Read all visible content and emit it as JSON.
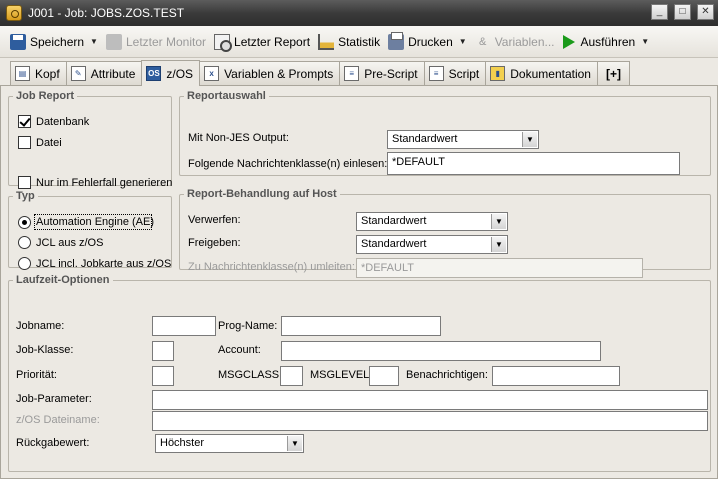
{
  "window": {
    "title": "J001 - Job: JOBS.ZOS.TEST",
    "min": "_",
    "max": "□",
    "close": "✕"
  },
  "toolbar": {
    "save": "Speichern",
    "last_monitor": "Letzter Monitor",
    "last_report": "Letzter Report",
    "statistics": "Statistik",
    "print": "Drucken",
    "variables": "Variablen...",
    "run": "Ausführen",
    "arrow": "▼"
  },
  "tabs": [
    {
      "label": "Kopf"
    },
    {
      "label": "Attribute"
    },
    {
      "label": "z/OS"
    },
    {
      "label": "Variablen & Prompts"
    },
    {
      "label": "Pre-Script"
    },
    {
      "label": "Script"
    },
    {
      "label": "Dokumentation"
    },
    {
      "label": "[+]"
    }
  ],
  "job_report": {
    "legend": "Job Report",
    "database": "Datenbank",
    "database_checked": true,
    "file": "Datei",
    "file_checked": false,
    "only_on_error": "Nur im Fehlerfall generieren",
    "only_on_error_checked": false
  },
  "report_selection": {
    "legend": "Reportauswahl",
    "non_jes_label": "Mit Non-JES Output:",
    "non_jes_value": "Standardwert",
    "msgclass_label": "Folgende Nachrichtenklasse(n) einlesen:",
    "msgclass_value": "*DEFAULT"
  },
  "type": {
    "legend": "Typ",
    "options": [
      "Automation Engine (AE)",
      "JCL aus z/OS",
      "JCL incl. Jobkarte aus z/OS"
    ],
    "selected": 0
  },
  "report_handling": {
    "legend": "Report-Behandlung auf Host",
    "discard_label": "Verwerfen:",
    "discard_value": "Standardwert",
    "release_label": "Freigeben:",
    "release_value": "Standardwert",
    "redirect_label": "Zu Nachrichtenklasse(n) umleiten:",
    "redirect_value": "*DEFAULT"
  },
  "runtime": {
    "legend": "Laufzeit-Optionen",
    "jobname": "Jobname:",
    "progname": "Prog-Name:",
    "jobclass": "Job-Klasse:",
    "account": "Account:",
    "priority": "Priorität:",
    "msgclass": "MSGCLASS:",
    "msglevel": "MSGLEVEL:",
    "notify": "Benachrichtigen:",
    "job_params": "Job-Parameter:",
    "zos_file": "z/OS Dateiname:",
    "return_value": "Rückgabewert:",
    "return_value_selected": "Höchster"
  },
  "colors": {
    "titlebar": "#3b3b3b",
    "background": "#ece9e3",
    "run_icon": "#1a9a1a"
  }
}
